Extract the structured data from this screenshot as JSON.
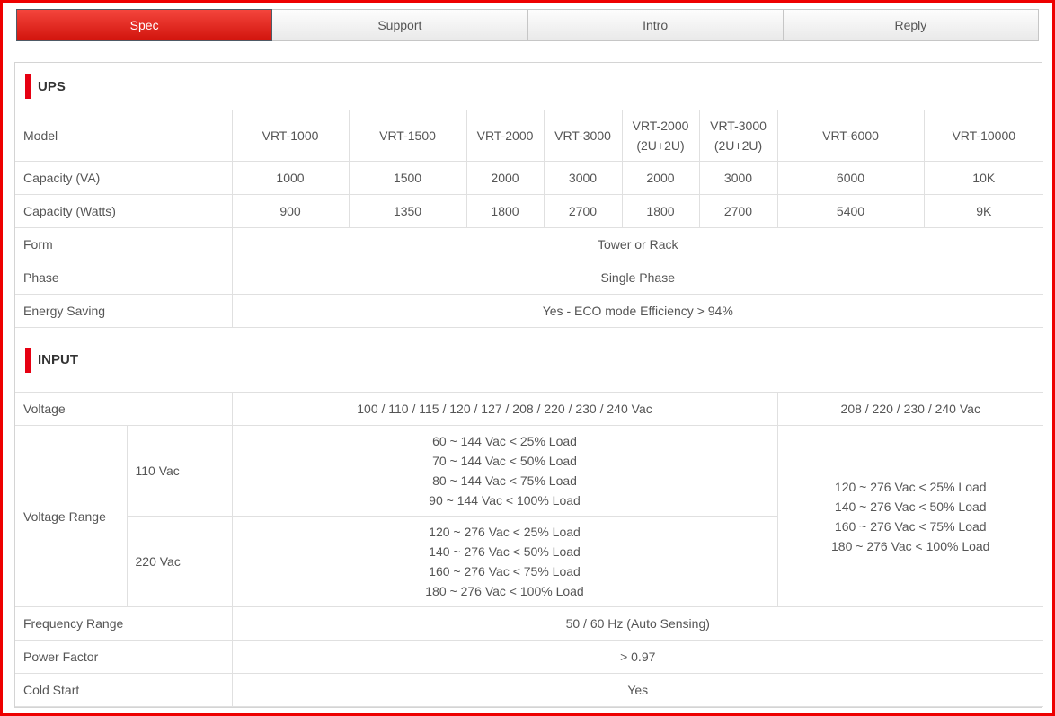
{
  "colors": {
    "frame_red": "#ee0000",
    "accent_red": "#e60012",
    "active_tab_red": "#d2140d"
  },
  "tabs": [
    {
      "label": "Spec",
      "active": true
    },
    {
      "label": "Support",
      "active": false
    },
    {
      "label": "Intro",
      "active": false
    },
    {
      "label": "Reply",
      "active": false
    }
  ],
  "ups": {
    "title": "UPS",
    "rows": {
      "model": {
        "label": "Model",
        "values": [
          "VRT-1000",
          "VRT-1500",
          "VRT-2000",
          "VRT-3000",
          "VRT-2000 (2U+2U)",
          "VRT-3000 (2U+2U)",
          "VRT-6000",
          "VRT-10000"
        ]
      },
      "capacity_va": {
        "label": "Capacity (VA)",
        "values": [
          "1000",
          "1500",
          "2000",
          "3000",
          "2000",
          "3000",
          "6000",
          "10K"
        ]
      },
      "capacity_watts": {
        "label": "Capacity (Watts)",
        "values": [
          "900",
          "1350",
          "1800",
          "2700",
          "1800",
          "2700",
          "5400",
          "9K"
        ]
      },
      "form": {
        "label": "Form",
        "value": "Tower or Rack"
      },
      "phase": {
        "label": "Phase",
        "value": "Single Phase"
      },
      "energy_saving": {
        "label": "Energy Saving",
        "value": "Yes - ECO mode Efficiency > 94%"
      }
    }
  },
  "input": {
    "title": "INPUT",
    "rows": {
      "voltage": {
        "label": "Voltage",
        "value_main": "100 / 110 / 115 / 120 / 127 / 208 / 220 / 230 / 240 Vac",
        "value_right": "208 / 220 / 230 / 240 Vac"
      },
      "voltage_range": {
        "label": "Voltage Range",
        "sub_110": {
          "label": "110 Vac",
          "value": "60 ~ 144 Vac < 25% Load\n70 ~ 144 Vac < 50% Load\n80 ~ 144 Vac < 75% Load\n90 ~ 144 Vac < 100% Load"
        },
        "sub_220": {
          "label": "220 Vac",
          "value": "120 ~ 276 Vac < 25% Load\n140 ~ 276 Vac < 50% Load\n160 ~ 276 Vac < 75% Load\n180 ~ 276 Vac < 100% Load"
        },
        "value_right": "120 ~ 276 Vac < 25% Load\n140 ~ 276 Vac < 50% Load\n160 ~ 276 Vac < 75% Load\n180 ~ 276 Vac < 100% Load"
      },
      "frequency_range": {
        "label": "Frequency Range",
        "value": "50 / 60 Hz (Auto Sensing)"
      },
      "power_factor": {
        "label": "Power Factor",
        "value": "> 0.97"
      },
      "cold_start": {
        "label": "Cold Start",
        "value": "Yes"
      }
    }
  }
}
